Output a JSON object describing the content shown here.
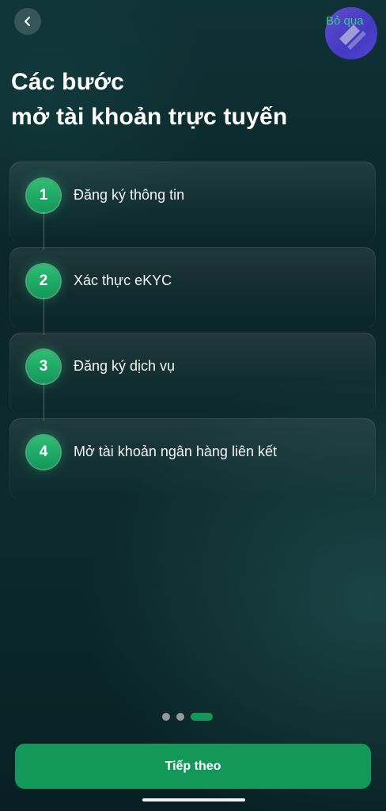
{
  "header": {
    "back_icon": "chevron-left-icon",
    "skip_label": "Bỏ qua"
  },
  "title": {
    "line1": "Các bước",
    "line2": "mở tài khoản trực tuyến"
  },
  "steps": [
    {
      "number": "1",
      "label": "Đăng ký thông tin"
    },
    {
      "number": "2",
      "label": "Xác thực eKYC"
    },
    {
      "number": "3",
      "label": "Đăng ký dịch vụ"
    },
    {
      "number": "4",
      "label": "Mở tài khoản ngân hàng liên kết"
    }
  ],
  "pager": {
    "total": 3,
    "active_index": 2
  },
  "footer": {
    "next_label": "Tiếp theo"
  },
  "colors": {
    "accent": "#13985a",
    "skip_text": "#2dd27f",
    "background": "#0b2528"
  }
}
